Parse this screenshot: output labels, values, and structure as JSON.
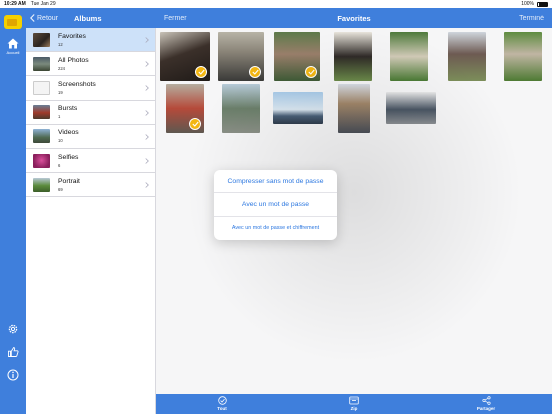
{
  "status_bar": {
    "time": "10:29 AM",
    "date": "Tue Jan 29",
    "battery": "100%"
  },
  "rail": {
    "home_label": "Accueil"
  },
  "albums_header": {
    "back_label": "Retour",
    "title": "Albums"
  },
  "photos_header": {
    "left_label": "Fermer",
    "title": "Favorites",
    "right_label": "Terminé"
  },
  "albums": [
    {
      "name": "Favorites",
      "count": "12",
      "selected": true
    },
    {
      "name": "All Photos",
      "count": "224",
      "selected": false
    },
    {
      "name": "Screenshots",
      "count": "19",
      "selected": false
    },
    {
      "name": "Bursts",
      "count": "1",
      "selected": false
    },
    {
      "name": "Videos",
      "count": "10",
      "selected": false
    },
    {
      "name": "Selfies",
      "count": "6",
      "selected": false
    },
    {
      "name": "Portrait",
      "count": "69",
      "selected": false
    }
  ],
  "photos": {
    "total_shown": 12,
    "selected_count": 4
  },
  "popover": {
    "options": [
      "Compresser sans mot de passe",
      "Avec un mot de passe",
      "Avec un mot de passe et chiffrement"
    ]
  },
  "toolbar": {
    "select_all_label": "Tout",
    "zip_label": "Zip",
    "share_label": "Partager"
  },
  "colors": {
    "accent": "#3f7fdc",
    "selected_row": "#cde1f9",
    "check": "#f3b611",
    "link": "#2d78e0"
  }
}
